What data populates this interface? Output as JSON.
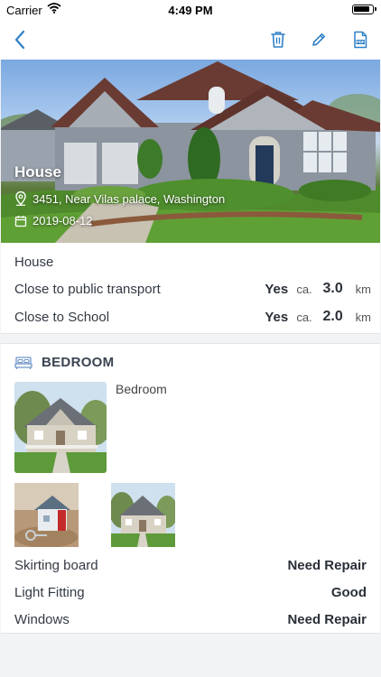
{
  "status_bar": {
    "carrier": "Carrier",
    "time": "4:49 PM"
  },
  "nav": {
    "back_icon": "chevron-left-icon",
    "actions": [
      "trash-icon",
      "pencil-icon",
      "pdf-icon"
    ],
    "accent_color": "#2f80c8"
  },
  "hero": {
    "title": "House",
    "address": "3451, Near Vilas palace, Washington",
    "date": "2019-08-12"
  },
  "info": {
    "type": "House",
    "rows": [
      {
        "label": "Close to public transport",
        "answer": "Yes",
        "ca": "ca.",
        "distance": "3.0",
        "unit": "km"
      },
      {
        "label": "Close to School",
        "answer": "Yes",
        "ca": "ca.",
        "distance": "2.0",
        "unit": "km"
      }
    ]
  },
  "room": {
    "icon": "bed-icon",
    "title": "BEDROOM",
    "description": "Bedroom",
    "conditions": [
      {
        "label": "Skirting board",
        "value": "Need Repair"
      },
      {
        "label": "Light Fitting",
        "value": "Good"
      },
      {
        "label": "Windows",
        "value": "Need Repair"
      }
    ]
  }
}
